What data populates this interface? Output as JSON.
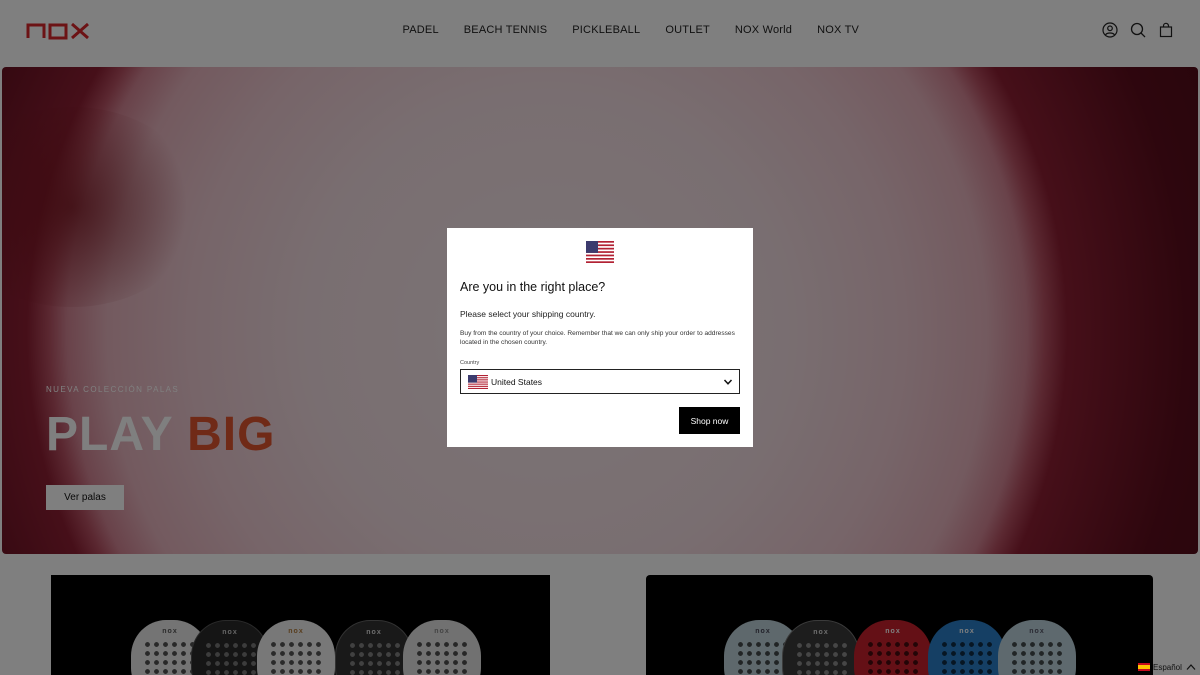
{
  "header": {
    "logo_text": "nox",
    "nav": [
      "PADEL",
      "BEACH TENNIS",
      "PICKLEBALL",
      "OUTLET",
      "NOX World",
      "NOX TV"
    ],
    "icons": [
      "account-icon",
      "search-icon",
      "cart-icon"
    ]
  },
  "hero": {
    "eyebrow": "NUEVA COLECCIÓN PALAS",
    "title_part1": "PLAY",
    "title_part2": "BIG",
    "button_label": "Ver palas"
  },
  "cards": [
    {
      "rackets": [
        "nox",
        "nox",
        "nox",
        "nox",
        "nox"
      ]
    },
    {
      "rackets": [
        "nox",
        "nox",
        "nox",
        "nox",
        "nox"
      ]
    }
  ],
  "modal": {
    "title": "Are you in the right place?",
    "subtitle": "Please select your shipping country.",
    "description": "Buy from the country of your choice. Remember that we can only ship your order to addresses located in the chosen country.",
    "country_label": "Country",
    "country_value": "United States",
    "button_label": "Shop now"
  },
  "language": {
    "label": "Español"
  },
  "colors": {
    "brand_red": "#d9262b",
    "accent_orange": "#e0542e",
    "button_black": "#000000"
  }
}
